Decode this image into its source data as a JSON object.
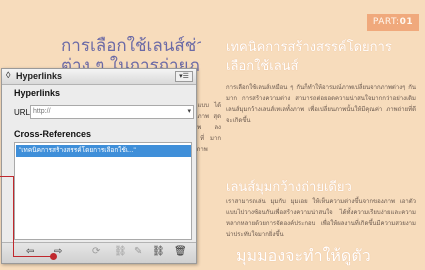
{
  "document": {
    "part_tag_prefix": "PART:",
    "part_tag_number": "01",
    "heading_left": "การเลือกใช้เลนส์ช่วง",
    "heading_left_line2": "ต่าง ๆ ในการถ่ายภาพ",
    "heading_right": "เทคนิคการสร้างสรรค์โดยการเลือกใช้เลนส์",
    "body_right_1": "การเลือกใช้เลนส์เหมือน ๆ กันก็ทำให้อารมณ์ภาพเปลี่ยนจากภาพต่างๆ กันมาก การสร้างความต่าง สามารถต่อยอดความน่าสนใจมากกว่าอย่างเดิม เลนส์มุมกว้างเลนส์เทเลทั้งภาพ เพื่อเปลี่ยนภาพนั้นให้มีคุณค่า ภาพถ่ายที่ดีจะเกิดขึ้น",
    "subheading_right": "เลนส์มุมกว้างถ่ายเดียว",
    "body_right_2": "เราสามารถเล่น มุมกับ มุมเอย ให้เห็นความต่างขึ้นจากของภาพ เอาตัวแบบไปวางซ้อนกันเพื่อสร้างความน่าสนใจ ได้ทั้งความเรียบง่ายและความหลากหลายด้วยการจัดองค์ประกอบ เพื่อให้ผลงานที่เกิดขึ้นมีความสวยงามน่าประทับใจมากยิ่งขึ้น",
    "bottom_heading": "มุมมองจะทำให้ดูตัว",
    "left_col_fragments": "เล็ก แบบ ได้ ต่าง ภาพ สุด ให้ภาพ ลง ตาม ที่ มาก แบบ ภาพ"
  },
  "panel": {
    "title": "Hyperlinks",
    "title_glyph": "◊",
    "menu_glyph": "▾☰",
    "section_hyperlinks": "Hyperlinks",
    "url_label": "URL:",
    "url_placeholder": "http://",
    "url_dropdown_glyph": "▾",
    "section_cross_refs": "Cross-References",
    "cross_refs": [
      {
        "label": "\"เทคนิคการสร้างสรรค์โดยการเลือกใช้เ...\"",
        "selected": true
      }
    ],
    "toolbar": {
      "prev": "⇦",
      "next": "⇨",
      "update": "⟳",
      "new_link": "⛓",
      "edit": "✎",
      "delete": "🗑"
    }
  },
  "colors": {
    "page_bg": "#f7dcbc",
    "accent_purple": "#6b6aa6",
    "part_tag_bg": "#f0a97c",
    "selection_blue": "#3f8fd9",
    "callout_red": "#c0282d"
  }
}
